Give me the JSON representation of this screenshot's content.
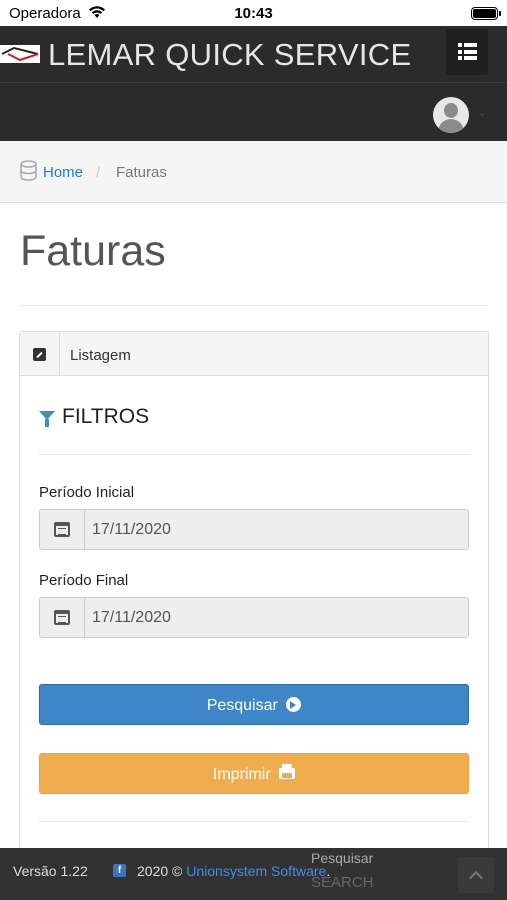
{
  "status_bar": {
    "carrier": "Operadora",
    "time": "10:43"
  },
  "navbar": {
    "brand": "LEMAR QUICK SERVICE"
  },
  "breadcrumb": {
    "home": "Home",
    "separator": "/",
    "current": "Faturas"
  },
  "page": {
    "title": "Faturas"
  },
  "panel": {
    "header": "Listagem",
    "filters_title": "FILTROS",
    "fields": {
      "start_label": "Período Inicial",
      "start_value": "17/11/2020",
      "end_label": "Período Final",
      "end_value": "17/11/2020"
    },
    "buttons": {
      "search": "Pesquisar",
      "print": "Imprimir"
    }
  },
  "footer": {
    "version": "Versão 1.22",
    "copyright_prefix": "2020 ©",
    "company": "Unionsystem Software",
    "copyright_suffix": ".",
    "search_label": "Pesquisar",
    "search_placeholder": "SEARCH"
  },
  "colors": {
    "navbar": "#2b2b2b",
    "primary": "#3f86c9",
    "warning": "#f0ad4e",
    "link": "#1f7bd6",
    "filter_icon": "#3a98a6"
  }
}
